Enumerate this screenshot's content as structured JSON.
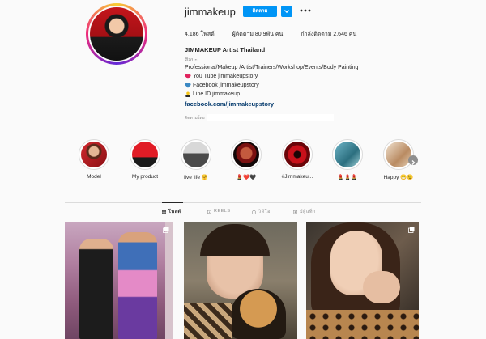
{
  "profile": {
    "username": "jimmakeup",
    "follow_label": "ติดตาม",
    "stats": {
      "posts": "4,186 โพสต์",
      "followers": "ผู้ติดตาม 80.9พัน คน",
      "following": "กำลังติดตาม 2,646 คน"
    },
    "bio": {
      "name": "JIMMAKEUP Artist Thailand",
      "category": "ศิลปะ",
      "line1": "Professional/Makeup /Artist/Trainers/Workshop/Events/Body Painting",
      "line2": "You Tube jimmakeupstory",
      "line3": "Facebook jimmakeupstory",
      "line4": "Line ID jimmakeup",
      "link": "facebook.com/jimmakeupstory",
      "followed_by": "ติดตามโดย"
    }
  },
  "highlights": [
    {
      "label": "Model"
    },
    {
      "label": "My product"
    },
    {
      "label": "live life 🤗"
    },
    {
      "label": "💄❤️🖤"
    },
    {
      "label": "#Jimmakeu..."
    },
    {
      "label": "💄💄💄"
    },
    {
      "label": "Happy 😁😉"
    }
  ],
  "tabs": [
    {
      "label": "โพสต์",
      "icon": "grid-icon",
      "active": true
    },
    {
      "label": "REELS",
      "icon": "reels-icon",
      "active": false
    },
    {
      "label": "วิดีโอ",
      "icon": "video-icon",
      "active": false
    },
    {
      "label": "มีผู้แท็ก",
      "icon": "tagged-icon",
      "active": false
    }
  ],
  "colors": {
    "accent": "#0095f6",
    "link": "#00376b",
    "muted": "#8e8e8e"
  }
}
